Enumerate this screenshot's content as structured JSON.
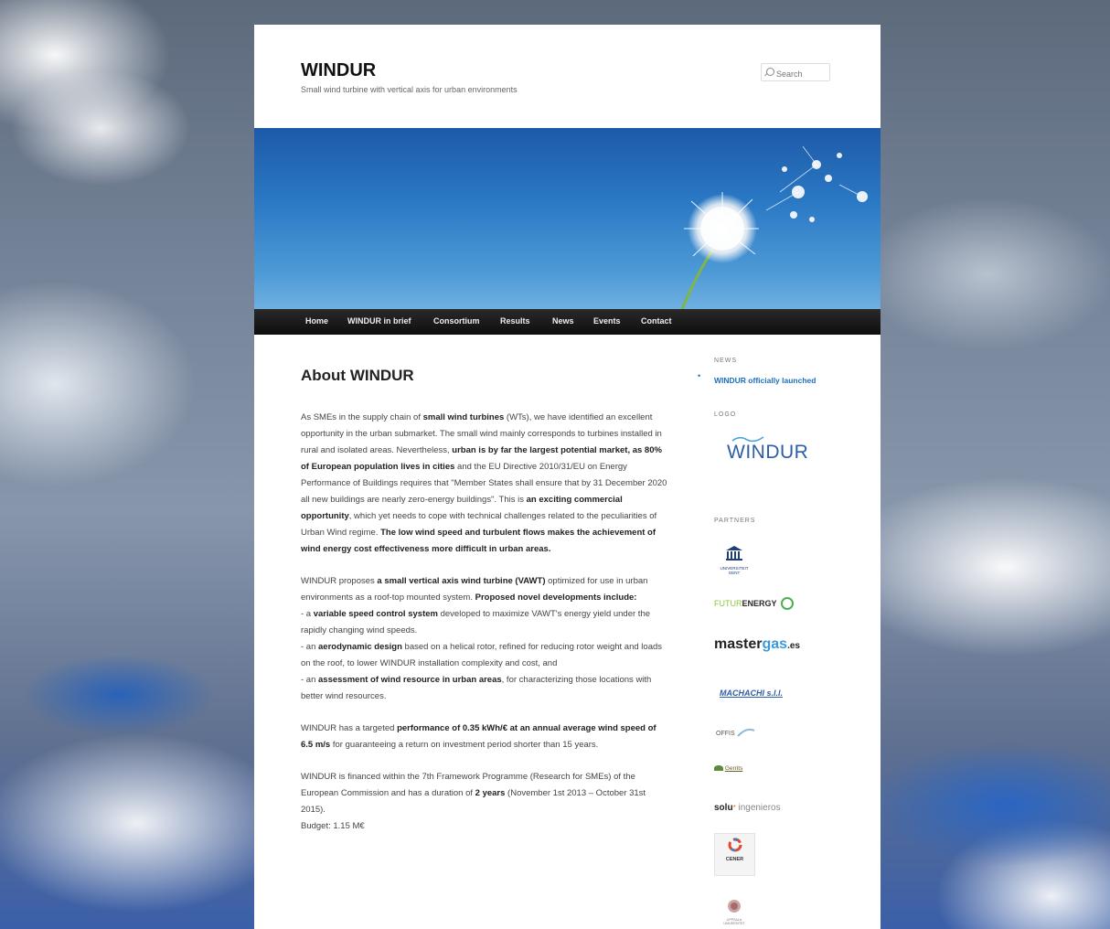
{
  "site": {
    "title": "WINDUR",
    "description": "Small wind turbine with vertical axis for urban environments"
  },
  "search": {
    "placeholder": "Search"
  },
  "nav": {
    "items": [
      {
        "label": "Home"
      },
      {
        "label": "WINDUR in brief"
      },
      {
        "label": "Consortium"
      },
      {
        "label": "Results"
      },
      {
        "label": "News"
      },
      {
        "label": "Events"
      },
      {
        "label": "Contact"
      }
    ]
  },
  "article": {
    "title": "About WINDUR",
    "p1": {
      "s1": "As SMEs in the supply chain of ",
      "b1": "small wind turbines",
      "s2": " (WTs), we have identified an excellent opportunity in the urban submarket. The small wind mainly corresponds to turbines installed in rural and isolated areas. Nevertheless, ",
      "b2": "urban is by far the largest potential market, as 80% of European population lives in cities",
      "s3": " and the EU Directive 2010/31/EU on Energy Performance of Buildings requires that \"Member States shall ensure that by 31 December 2020 all new buildings are nearly zero-energy buildings\". This is ",
      "b3": "an exciting commercial opportunity",
      "s4": ", which yet needs to cope with technical challenges related to the peculiarities of Urban Wind regime. ",
      "b4": "The low wind speed and turbulent flows makes the achievement of wind energy cost effectiveness more difficult in urban areas."
    },
    "p2": {
      "s1": "WINDUR proposes ",
      "b1": "a small vertical axis wind turbine (VAWT)",
      "s2": " optimized for use in urban environments as a roof-top mounted system. ",
      "b2": "Proposed novel developments include:",
      "l1a": "- a ",
      "l1b": "variable speed control system",
      "l1c": " developed to maximize VAWT's energy yield under the rapidly changing wind speeds.",
      "l2a": "- an ",
      "l2b": "aerodynamic design",
      "l2c": " based on a helical rotor, refined for reducing rotor weight and loads on the roof, to lower WINDUR installation complexity and cost, and",
      "l3a": "- an ",
      "l3b": "assessment of wind resource in urban areas",
      "l3c": ", for characterizing those locations with better wind resources."
    },
    "p3": {
      "s1": "WINDUR has a targeted ",
      "b1": "performance of 0.35 kWh/€ at an annual average wind speed of 6.5 m/s",
      "s2": " for guaranteeing a return on investment period shorter than 15 years."
    },
    "p4": {
      "s1": "WINDUR is financed within the 7th Framework Programme (Research for SMEs) of the European Commission and has a duration of ",
      "b1": "2 years",
      "s2": " (November 1st 2013 – October 31st 2015).",
      "budget": "Budget: 1.15 M€"
    }
  },
  "sidebar": {
    "news_title": "NEWS",
    "news_items": [
      {
        "label": "WINDUR officially launched"
      }
    ],
    "logo_title": "LOGO",
    "logo_text": "WINDUR",
    "partners_title": "PARTNERS",
    "partners": [
      {
        "name": "UNIVERSITEIT GENT"
      },
      {
        "name_a": "FUTUR",
        "name_b": "ENERGY"
      },
      {
        "name_a": "master",
        "name_b": "gas",
        "name_c": ".es"
      },
      {
        "name": "MACHACHI s.l.l."
      },
      {
        "name": "OFFIS"
      },
      {
        "name": "Gerrits"
      },
      {
        "name_a": "solu",
        "name_b": "ingenieros"
      },
      {
        "name": "CENER"
      },
      {
        "name": "UPPSALA UNIVERSITET"
      }
    ]
  },
  "colors": {
    "nav_bg": "#111111",
    "link": "#1b6fc1",
    "sky": "#2a78c4"
  }
}
